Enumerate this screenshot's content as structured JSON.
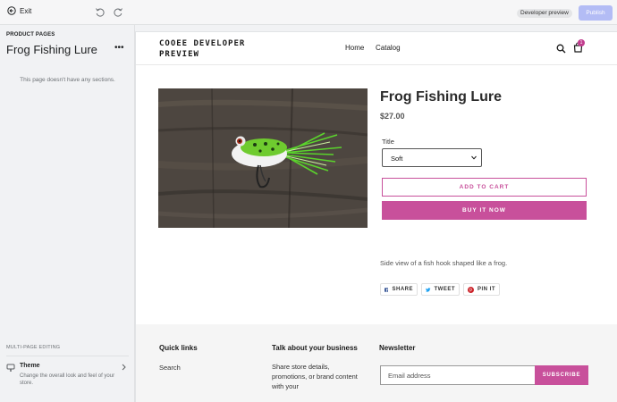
{
  "topbar": {
    "exit_label": "Exit",
    "dev_badge": "Developer preview",
    "publish_label": "Publish"
  },
  "sidebar": {
    "eyebrow": "PRODUCT PAGES",
    "title": "Frog Fishing Lure",
    "more_label": "•••",
    "empty_text": "This page doesn't have any sections.",
    "multi_label": "MULTI-PAGE EDITING",
    "theme_title": "Theme",
    "theme_desc": "Change the overall look and feel of your store."
  },
  "store": {
    "name": "COOEE DEVELOPER PREVIEW",
    "nav": [
      "Home",
      "Catalog"
    ],
    "cart_count": "1"
  },
  "product": {
    "title": "Frog Fishing Lure",
    "price": "$27.00",
    "option_label": "Title",
    "option_value": "Soft",
    "add_to_cart": "ADD TO CART",
    "buy_now": "BUY IT NOW",
    "description": "Side view of a fish hook shaped like a frog.",
    "share": [
      "SHARE",
      "TWEET",
      "PIN IT"
    ]
  },
  "footer": {
    "quick_links_heading": "Quick links",
    "quick_links": [
      "Search"
    ],
    "talk_heading": "Talk about your business",
    "talk_text": "Share store details, promotions, or brand content with your",
    "newsletter_heading": "Newsletter",
    "email_placeholder": "Email address",
    "subscribe_label": "SUBSCRIBE"
  },
  "colors": {
    "accent": "#c8509b",
    "publish_disabled": "#b3bcf5"
  }
}
